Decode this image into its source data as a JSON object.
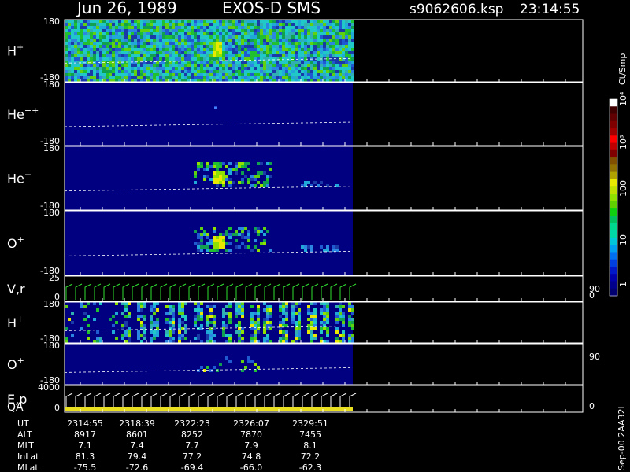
{
  "header": {
    "date": "Jun 26, 1989",
    "mission": "EXOS-D SMS",
    "file": "s9062606.ksp",
    "time": "23:14:55"
  },
  "colorbar": {
    "unit": "Ct/Smp",
    "tick_labels": [
      "1",
      "10",
      "100",
      "10³",
      "10⁴"
    ],
    "colors": [
      "#000070",
      "#00008c",
      "#0000aa",
      "#0018c8",
      "#0040e0",
      "#0070f0",
      "#00a0f0",
      "#00c8d8",
      "#00d8a8",
      "#00d890",
      "#00c060",
      "#10d010",
      "#60d000",
      "#90e000",
      "#c0e000",
      "#e8e800",
      "#b0a000",
      "#907000",
      "#805000",
      "#800000",
      "#c00000",
      "#ff0000",
      "#a00000",
      "#800000",
      "#600000",
      "#400000",
      "#ffffff"
    ]
  },
  "footer": {
    "rows": [
      {
        "label": "UT",
        "values": [
          "2314:55",
          "2318:39",
          "2322:23",
          "2326:07",
          "2329:51"
        ]
      },
      {
        "label": "ALT",
        "values": [
          "8917",
          "8601",
          "8252",
          "7870",
          "7455"
        ]
      },
      {
        "label": "MLT",
        "values": [
          "7.1",
          "7.4",
          "7.7",
          "7.9",
          "8.1"
        ]
      },
      {
        "label": "InLat",
        "values": [
          "81.3",
          "79.4",
          "77.2",
          "74.8",
          "72.2"
        ]
      },
      {
        "label": "MLat",
        "values": [
          "-75.5",
          "-72.6",
          "-69.4",
          "-66.0",
          "-62.3"
        ]
      }
    ],
    "stamp": "Sep-00 2AA32L"
  },
  "chart_data": {
    "type": "heatmap",
    "panels": [
      {
        "label": "H",
        "sup": "+",
        "ytop": "180",
        "ybot": "-180",
        "intensity": "high"
      },
      {
        "label": "He",
        "sup": "++",
        "ytop": "180",
        "ybot": "-180",
        "intensity": "none"
      },
      {
        "label": "He",
        "sup": "+",
        "ytop": "180",
        "ybot": "-180",
        "intensity": "medium"
      },
      {
        "label": "O",
        "sup": "+",
        "ytop": "180",
        "ybot": "-180",
        "intensity": "medium"
      },
      {
        "label": "V,r",
        "sup": "",
        "ytop": "25",
        "ybot": "0",
        "right_top": "90",
        "right_bot": "0",
        "type": "line"
      },
      {
        "label": "H",
        "sup": "+",
        "ytop": "180",
        "ybot": "-180",
        "intensity": "stripes"
      },
      {
        "label": "O",
        "sup": "+",
        "ytop": "180",
        "ybot": "-180",
        "right_top": "90",
        "intensity": "low"
      },
      {
        "label": "E,p",
        "sub_label": "QA",
        "sup": "",
        "ytop": "4000",
        "ybot": "0",
        "right_bot": "0",
        "type": "line"
      }
    ],
    "x_ticks": [
      "2314:55",
      "2318:39",
      "2322:23",
      "2326:07",
      "2329:51"
    ]
  }
}
